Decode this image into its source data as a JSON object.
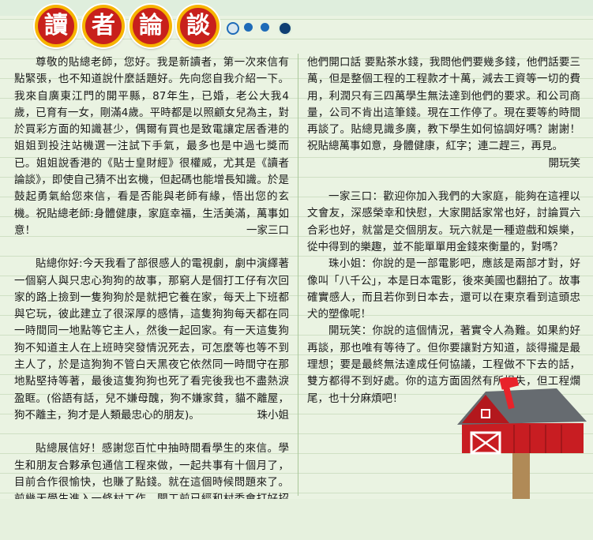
{
  "header": {
    "title_chars": [
      "讀",
      "者",
      "論",
      "談"
    ],
    "colors": {
      "badge_fill": "#c8201c",
      "badge_ring": "#f6b400",
      "accent_blue": "#1e6bb8",
      "paper": "#eaf3e2"
    }
  },
  "left_column": {
    "letter1": {
      "text": "尊敬的貼總老師，您好。我是新讀者，第一次來信有點緊張，也不知道說什麼話題好。先向您自我介紹一下。我來自廣東江門的開平縣，87年生，已婚，老公大我4歲，已育有一女，剛滿4歲。平時都是以照顧女兒為主，對於買彩方面的知識甚少，偶爾有買也是致電讓定居香港的姐姐到投注站機選一注試下手氣，最多也是中過七獎而已。姐姐說香港的《貼士皇財經》很權威，尤其是《讀者論談》，即使自己猜不出玄機，但起碼也能增長知識。於是鼓起勇氣給您來信，看是否能與老師有緣，悟出您的玄機。祝貼總老師:身體健康，家庭幸福，生活美滿，萬事如意！",
      "signature": "一家三口"
    },
    "letter2": {
      "text": "貼總你好:今天我看了部很感人的電視劇，劇中演繹著一個窮人與只忠心狗狗的故事，那窮人是個打工仔有次回家的路上撿到一隻狗狗於是就把它養在家，每天上下班都與它玩，彼此建立了很深厚的感情，這隻狗狗每天都在同一時間同一地點等它主人，然後一起回家。有一天這隻狗狗不知道主人在上班時突發情況死去，可怎麼等也等不到主人了，於是這狗狗不管白天黑夜它依然同一時間守在那地點堅持等著，最後這隻狗狗也死了看完後我也不盡熱淚盈眶。(俗語有話，兒不嫌母醜，狗不嫌家貧，貓不離屋，狗不離主，狗才是人類最忠心的朋友)。",
      "signature": "珠小姐"
    },
    "letter3": {
      "text": "貼總展信好！感謝您百忙中抽時間看學生的來信。學生和朋友合夥承包通信工程來做，一起共事有十個月了，目前合作很愉快，也賺了點錢。就在這個時候問題來了。前幾天學生進入一條村工作，開工前已經和村委會打好招呼，再入去開工的，點想也想不到做到一半，村的副主任突然間帶人來講話不給做，還話沒和村委會打招呼，呵呵！經過協調"
    }
  },
  "right_column": {
    "letter3_cont": {
      "text": "他們開口話 要點茶水錢，我問他們要幾多錢，他們話要三萬，但是整個工程的工程款才十萬，減去工資等一切的費用，利潤只有三四萬學生無法達到他們的要求。和公司商量，公司不肯出這筆錢。現在工作停了。現在要等約時間再談了。貼總見識多廣，教下學生如何協調好嗎？謝謝！祝貼總萬事如意，身體健康，紅字；連二趕三，再見。",
      "signature": "開玩笑"
    },
    "replies": [
      {
        "text": "一家三口：歡迎你加入我們的大家庭，能夠在這裡以文會友，深感榮幸和快慰，大家開話家常也好，討論買六合彩也好，就當是交個朋友。玩六就是一種遊戲和娛樂，從中得到的樂趣，並不能單單用金錢來衡量的，對嗎？"
      },
      {
        "text": "珠小姐：你說的是一部電影吧，應該是兩部才對，好像叫「八千公」，本是日本電影，後來美國也翻拍了。故事確實感人，而且若你到日本去，還可以在東京看到這頭忠犬的塑像呢！"
      },
      {
        "text": "開玩笑：你說的這個情況，著實令人為難。如果約好再談，那也唯有等待了。但你要讓對方知道，談得攏是最理想；要是最終無法達成任何協議，工程做不下去的話，雙方都得不到好處。你的這方面固然有所損失，但工程爛尾，也十分麻煩吧！"
      }
    ]
  },
  "illustration": {
    "icon": "red-barn-mailbox-icon",
    "colors": {
      "barn": "#c81d22",
      "roof": "#666b70",
      "post": "#b08a57",
      "trim": "#ffffff"
    }
  }
}
